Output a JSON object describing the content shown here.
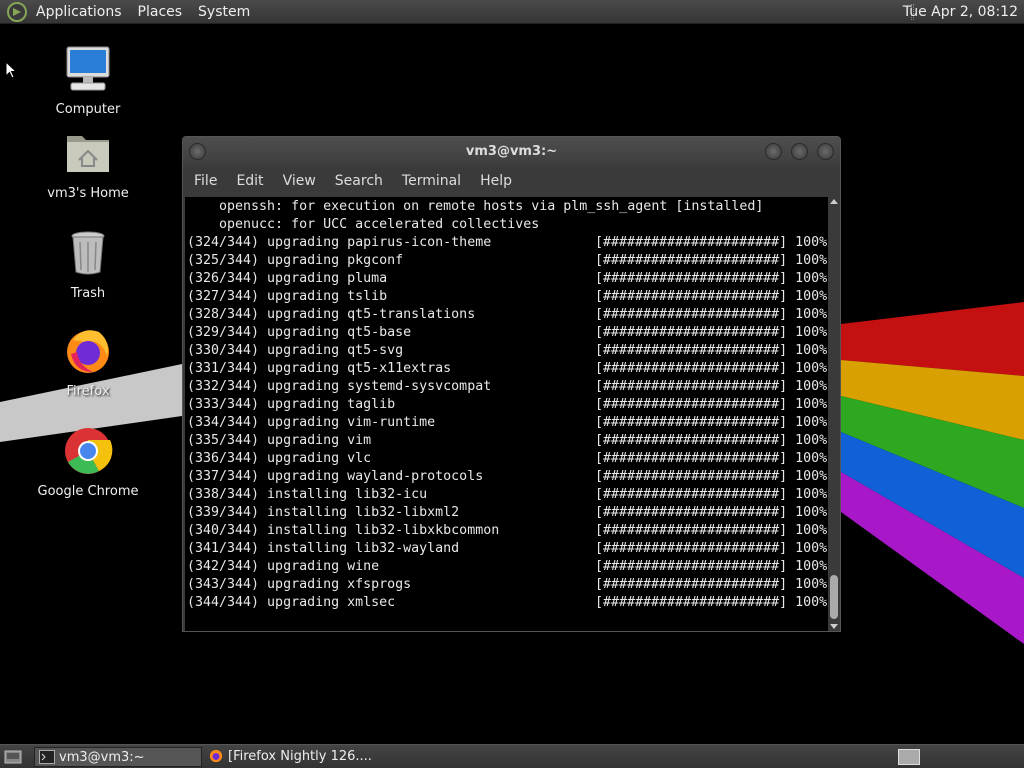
{
  "top_panel": {
    "menus": [
      "Applications",
      "Places",
      "System"
    ],
    "clock": "Tue Apr  2, 08:12"
  },
  "desktop_icons": [
    {
      "label": "Computer",
      "icon": "computer-icon"
    },
    {
      "label": "vm3's Home",
      "icon": "home-folder-icon"
    },
    {
      "label": "Trash",
      "icon": "trash-icon"
    },
    {
      "label": "Firefox",
      "icon": "firefox-icon"
    },
    {
      "label": "Google Chrome",
      "icon": "chrome-icon"
    }
  ],
  "terminal": {
    "title": "vm3@vm3:~",
    "menus": [
      "File",
      "Edit",
      "View",
      "Search",
      "Terminal",
      "Help"
    ],
    "lines": [
      {
        "text": "    openssh: for execution on remote hosts via plm_ssh_agent [installed]",
        "progress": ""
      },
      {
        "text": "    openucc: for UCC accelerated collectives",
        "progress": ""
      },
      {
        "text": "(324/344) upgrading papirus-icon-theme",
        "progress": "[######################] 100%"
      },
      {
        "text": "(325/344) upgrading pkgconf",
        "progress": "[######################] 100%"
      },
      {
        "text": "(326/344) upgrading pluma",
        "progress": "[######################] 100%"
      },
      {
        "text": "(327/344) upgrading tslib",
        "progress": "[######################] 100%"
      },
      {
        "text": "(328/344) upgrading qt5-translations",
        "progress": "[######################] 100%"
      },
      {
        "text": "(329/344) upgrading qt5-base",
        "progress": "[######################] 100%"
      },
      {
        "text": "(330/344) upgrading qt5-svg",
        "progress": "[######################] 100%"
      },
      {
        "text": "(331/344) upgrading qt5-x11extras",
        "progress": "[######################] 100%"
      },
      {
        "text": "(332/344) upgrading systemd-sysvcompat",
        "progress": "[######################] 100%"
      },
      {
        "text": "(333/344) upgrading taglib",
        "progress": "[######################] 100%"
      },
      {
        "text": "(334/344) upgrading vim-runtime",
        "progress": "[######################] 100%"
      },
      {
        "text": "(335/344) upgrading vim",
        "progress": "[######################] 100%"
      },
      {
        "text": "(336/344) upgrading vlc",
        "progress": "[######################] 100%"
      },
      {
        "text": "(337/344) upgrading wayland-protocols",
        "progress": "[######################] 100%"
      },
      {
        "text": "(338/344) installing lib32-icu",
        "progress": "[######################] 100%"
      },
      {
        "text": "(339/344) installing lib32-libxml2",
        "progress": "[######################] 100%"
      },
      {
        "text": "(340/344) installing lib32-libxkbcommon",
        "progress": "[######################] 100%"
      },
      {
        "text": "(341/344) installing lib32-wayland",
        "progress": "[######################] 100%"
      },
      {
        "text": "(342/344) upgrading wine",
        "progress": "[######################] 100%"
      },
      {
        "text": "(343/344) upgrading xfsprogs",
        "progress": "[######################] 100%"
      },
      {
        "text": "(344/344) upgrading xmlsec",
        "progress": "[######################] 100%"
      }
    ]
  },
  "taskbar": {
    "tasks": [
      {
        "label": "vm3@vm3:~",
        "icon": "terminal-icon",
        "active": true
      },
      {
        "label": "[Firefox Nightly 126....",
        "icon": "firefox-icon",
        "active": false
      }
    ]
  },
  "colors": {
    "panel": "#3d3d3d",
    "terminal_bg": "#000000",
    "terminal_fg": "#e8e8e8"
  }
}
